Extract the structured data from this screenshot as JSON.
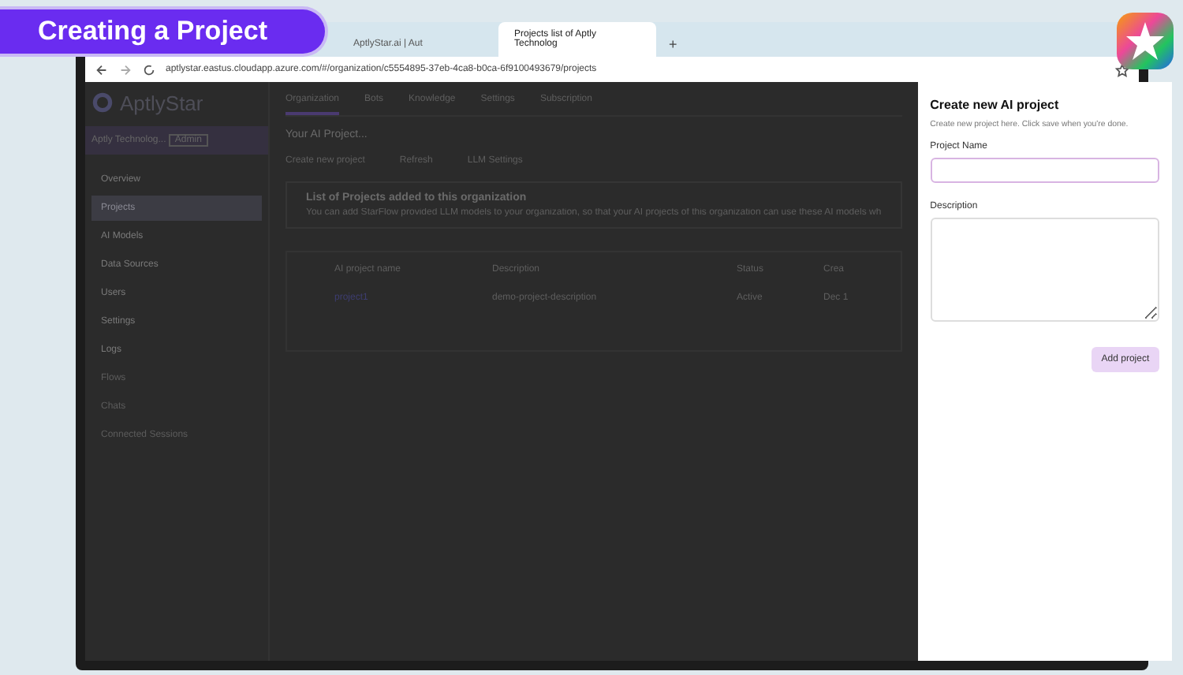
{
  "banner": {
    "title": "Creating a Project"
  },
  "browser": {
    "tabs": [
      {
        "label": "AptlyStar.ai | Aut",
        "selected": false
      },
      {
        "label": "Projects list of Aptly Technolog",
        "selected": true
      }
    ],
    "new_tab": "+",
    "url": "aptlystar.eastus.cloudapp.azure.com/#/organization/c5554895-37eb-4ca8-b0ca-6f9100493679/projects"
  },
  "app": {
    "logo": "AptlyStar",
    "org": {
      "name": "Aptly Technolog...",
      "badge": "Admin"
    },
    "sidebar": [
      {
        "label": "Overview",
        "selected": false,
        "disabled": false
      },
      {
        "label": "Projects",
        "selected": true,
        "disabled": false
      },
      {
        "label": "AI Models",
        "selected": false,
        "disabled": false
      },
      {
        "label": "Data Sources",
        "selected": false,
        "disabled": false
      },
      {
        "label": "Users",
        "selected": false,
        "disabled": false
      },
      {
        "label": "Settings",
        "selected": false,
        "disabled": false
      },
      {
        "label": "Logs",
        "selected": false,
        "disabled": false
      },
      {
        "label": "Flows",
        "selected": false,
        "disabled": true
      },
      {
        "label": "Chats",
        "selected": false,
        "disabled": true
      },
      {
        "label": "Connected Sessions",
        "selected": false,
        "disabled": true
      }
    ],
    "tabs": [
      {
        "label": "Organization",
        "selected": true
      },
      {
        "label": "Bots",
        "selected": false
      },
      {
        "label": "Knowledge",
        "selected": false
      },
      {
        "label": "Settings",
        "selected": false
      },
      {
        "label": "Subscription",
        "selected": false
      }
    ],
    "heading": "Your AI Project...",
    "actions": [
      "Create new project",
      "Refresh",
      "LLM Settings"
    ],
    "info": {
      "title": "List of Projects added to this organization",
      "text": "You can add StarFlow provided LLM models to your organization, so that your AI projects of this organization can use these AI models wh"
    },
    "table": {
      "columns": [
        "AI project name",
        "Description",
        "Status",
        "Crea"
      ],
      "rows": [
        {
          "cells": [
            "project1",
            "demo-project-description",
            "Active",
            "Dec 1"
          ]
        }
      ]
    }
  },
  "drawer": {
    "title": "Create new AI project",
    "subtitle": "Create new project here. Click save when you're done.",
    "fields": [
      {
        "label": "Project Name",
        "kind": "input",
        "focused": true
      },
      {
        "label": "Description",
        "kind": "textarea",
        "focused": false
      }
    ],
    "button": "Add project"
  }
}
